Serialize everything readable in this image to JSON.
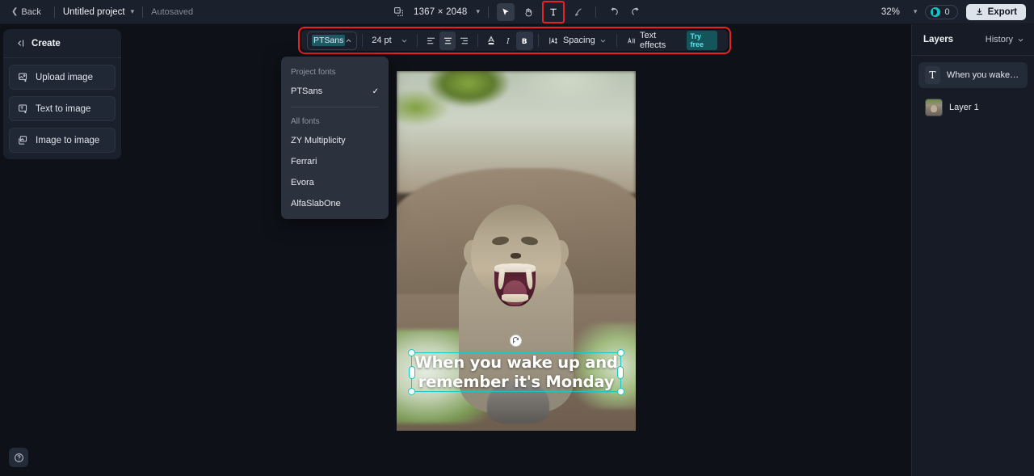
{
  "topbar": {
    "back_label": "Back",
    "project_name": "Untitled project",
    "autosaved_label": "Autosaved",
    "dimensions": "1367 × 2048",
    "zoom_level": "32%",
    "credits_count": "0",
    "export_label": "Export",
    "tools": [
      {
        "name": "artboard-icon",
        "active": false
      },
      {
        "name": "select-tool",
        "active": true
      },
      {
        "name": "hand-tool",
        "active": false
      },
      {
        "name": "text-tool",
        "active": true,
        "highlighted": true
      },
      {
        "name": "brush-tool",
        "active": false
      },
      {
        "name": "undo-button",
        "active": false
      },
      {
        "name": "redo-button",
        "active": false
      }
    ]
  },
  "left_panel": {
    "header": "Create",
    "items": [
      {
        "label": "Upload image",
        "icon": "upload-image-icon"
      },
      {
        "label": "Text to image",
        "icon": "text-to-image-icon"
      },
      {
        "label": "Image to image",
        "icon": "image-to-image-icon"
      }
    ],
    "help_label": "?"
  },
  "text_toolbar": {
    "font_family": "PTSans",
    "font_size": "24 pt",
    "align_left": "Align left",
    "align_center": "Align center",
    "align_right": "Align right",
    "text_color": "Text color",
    "italic": "Italic",
    "bold": "Bold",
    "spacing_label": "Spacing",
    "text_effects_label": "Text effects",
    "try_free_label": "Try free",
    "highlight_color": "#e8231f"
  },
  "font_dropdown": {
    "project_fonts_label": "Project fonts",
    "all_fonts_label": "All fonts",
    "project_fonts": [
      {
        "name": "PTSans",
        "selected": true
      }
    ],
    "all_fonts": [
      {
        "name": "ZY Multiplicity",
        "selected": false
      },
      {
        "name": "Ferrari",
        "selected": false
      },
      {
        "name": "Evora",
        "selected": false
      },
      {
        "name": "AlfaSlabOne",
        "selected": false
      }
    ],
    "check_glyph": "✓"
  },
  "canvas": {
    "text_line_1": "When you wake up and",
    "text_line_2": "remember it's Monday",
    "selection_color": "#19c6c9",
    "text_color": "#ffffff"
  },
  "right_panel": {
    "title": "Layers",
    "history_label": "History",
    "layers": [
      {
        "name": "When you wake up …",
        "type": "text",
        "selected": true
      },
      {
        "name": "Layer 1",
        "type": "image",
        "selected": false
      }
    ]
  }
}
